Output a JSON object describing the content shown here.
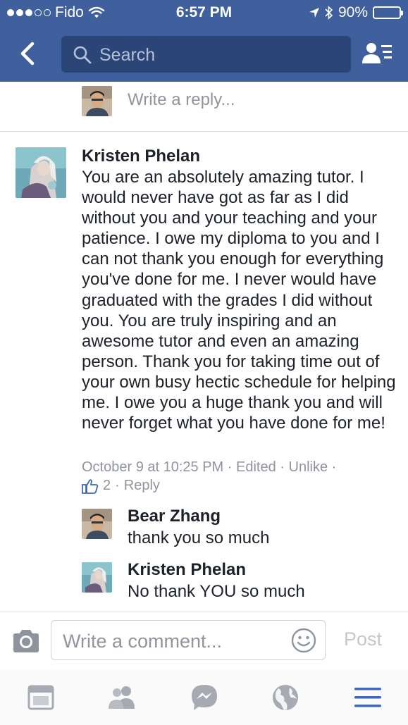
{
  "status_bar": {
    "carrier": "Fido",
    "time": "6:57 PM",
    "battery": "90%",
    "battery_level": 0.9
  },
  "nav": {
    "search_placeholder": "Search"
  },
  "reply_prompt": "Write a reply...",
  "comment": {
    "author": "Kristen Phelan",
    "text": "You are an absolutely amazing tutor. I would never have got as far as I did without you and your teaching and your patience. I owe my diploma to you and I can not thank you enough for everything you've done for me. I never would have graduated with the grades I did without you. You are truly inspiring and an awesome tutor and even an amazing person. Thank you for taking time out of your own busy hectic schedule for helping me. I owe you a huge thank you and will never forget what you have done for me!",
    "timestamp": "October 9 at 10:25 PM",
    "edited": "Edited",
    "unlike": "Unlike",
    "likes": "2",
    "reply": "Reply"
  },
  "replies": [
    {
      "author": "Bear Zhang",
      "text": "thank you so much"
    },
    {
      "author": "Kristen Phelan",
      "text": "No thank YOU so much"
    }
  ],
  "composer": {
    "placeholder": "Write a comment...",
    "post_label": "Post"
  },
  "tabs": [
    "news-feed",
    "friends",
    "messenger",
    "notifications",
    "menu"
  ],
  "colors": {
    "brand": "#3f5f9d",
    "search_bg": "#2c4577",
    "text": "#1d2129",
    "meta": "#90949c",
    "tab_active": "#4267b2"
  }
}
